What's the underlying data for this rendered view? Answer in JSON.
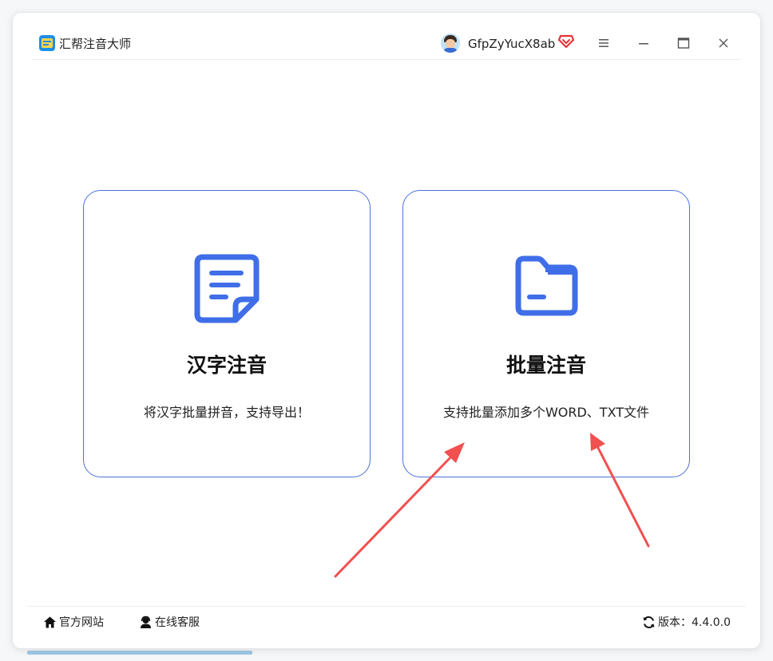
{
  "window": {
    "app_title": "汇帮注音大师",
    "username": "GfpZyYucX8ab",
    "icons": {
      "logo": "app-logo-icon",
      "avatar": "user-avatar",
      "vip": "vip-diamond-icon",
      "menu": "menu-icon",
      "minimize": "minimize-icon",
      "maximize": "maximize-icon",
      "close": "close-icon"
    }
  },
  "cards": [
    {
      "icon": "document-icon",
      "title": "汉字注音",
      "description": "将汉字批量拼音，支持导出！"
    },
    {
      "icon": "folder-icon",
      "title": "批量注音",
      "description": "支持批量添加多个WORD、TXT文件"
    }
  ],
  "footer": {
    "site_label": "官方网站",
    "service_label": "在线客服",
    "version_label": "版本：4.4.0.0",
    "icons": {
      "site": "home-icon",
      "service": "support-icon",
      "version": "refresh-icon"
    }
  },
  "colors": {
    "accent": "#3f6ee8",
    "card_border": "#4a73d9",
    "annotation_arrow": "#f0504f",
    "vip": "#e8343a"
  }
}
